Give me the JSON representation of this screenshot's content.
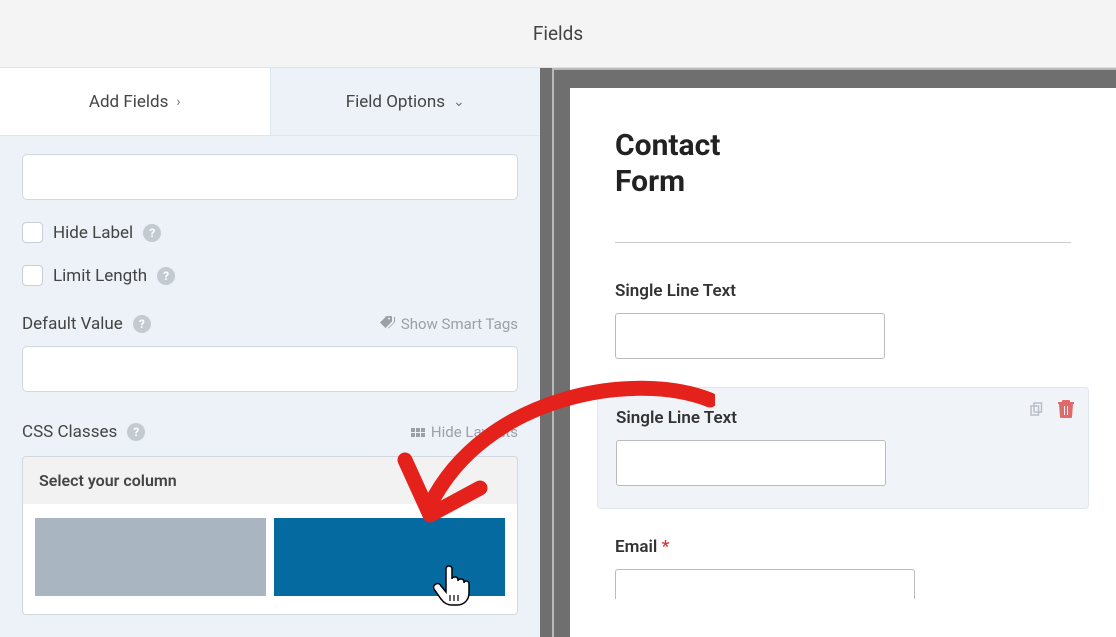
{
  "header": {
    "title": "Fields"
  },
  "sidebar": {
    "tabs": {
      "add_fields": "Add Fields",
      "field_options": "Field Options"
    },
    "hide_label": "Hide Label",
    "limit_length": "Limit Length",
    "default_value": "Default Value",
    "show_smart_tags": "Show Smart Tags",
    "css_classes": "CSS Classes",
    "hide_layouts": "Hide Layouts",
    "select_column": "Select your column"
  },
  "preview": {
    "form_title": "Contact Form",
    "field1_label": "Single Line Text",
    "field2_label": "Single Line Text",
    "email_label": "Email"
  }
}
